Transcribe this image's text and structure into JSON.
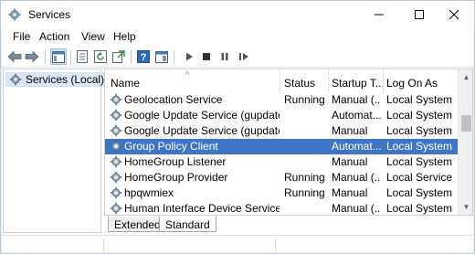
{
  "window": {
    "title": "Services",
    "app_icon": "gear-icon"
  },
  "menu": [
    {
      "label": "File"
    },
    {
      "label": "Action"
    },
    {
      "label": "View"
    },
    {
      "label": "Help"
    }
  ],
  "toolbar": {
    "icons": [
      "back-arrow-icon",
      "forward-arrow-icon",
      "console-tree-icon",
      "properties-icon",
      "refresh-icon",
      "export-list-icon",
      "help-icon",
      "show-action-pane-icon",
      "start-service-icon",
      "stop-service-icon",
      "pause-service-icon",
      "restart-service-icon"
    ]
  },
  "tree": {
    "selected_label": "Services (Local)"
  },
  "columns": [
    {
      "label": "Name"
    },
    {
      "label": "Status"
    },
    {
      "label": "Startup T..."
    },
    {
      "label": "Log On As"
    }
  ],
  "services": [
    {
      "name": "Geolocation Service",
      "status": "Running",
      "startup": "Manual (...",
      "logon": "Local System",
      "selected": false
    },
    {
      "name": "Google Update Service (gupdate)",
      "status": "",
      "startup": "Automat...",
      "logon": "Local System",
      "selected": false
    },
    {
      "name": "Google Update Service (gupdate...",
      "status": "",
      "startup": "Manual",
      "logon": "Local System",
      "selected": false
    },
    {
      "name": "Group Policy Client",
      "status": "",
      "startup": "Automat...",
      "logon": "Local System",
      "selected": true
    },
    {
      "name": "HomeGroup Listener",
      "status": "",
      "startup": "Manual",
      "logon": "Local System",
      "selected": false
    },
    {
      "name": "HomeGroup Provider",
      "status": "Running",
      "startup": "Manual (...",
      "logon": "Local Service",
      "selected": false
    },
    {
      "name": "hpqwmiex",
      "status": "Running",
      "startup": "Manual",
      "logon": "Local System",
      "selected": false
    },
    {
      "name": "Human Interface Device Service",
      "status": "",
      "startup": "Manual (...",
      "logon": "Local System",
      "selected": false
    }
  ],
  "tabs": [
    {
      "label": "Extended",
      "active": false
    },
    {
      "label": "Standard",
      "active": true
    }
  ],
  "colors": {
    "selection": "#3f75c6",
    "tree_selection": "#d9e8f7"
  }
}
